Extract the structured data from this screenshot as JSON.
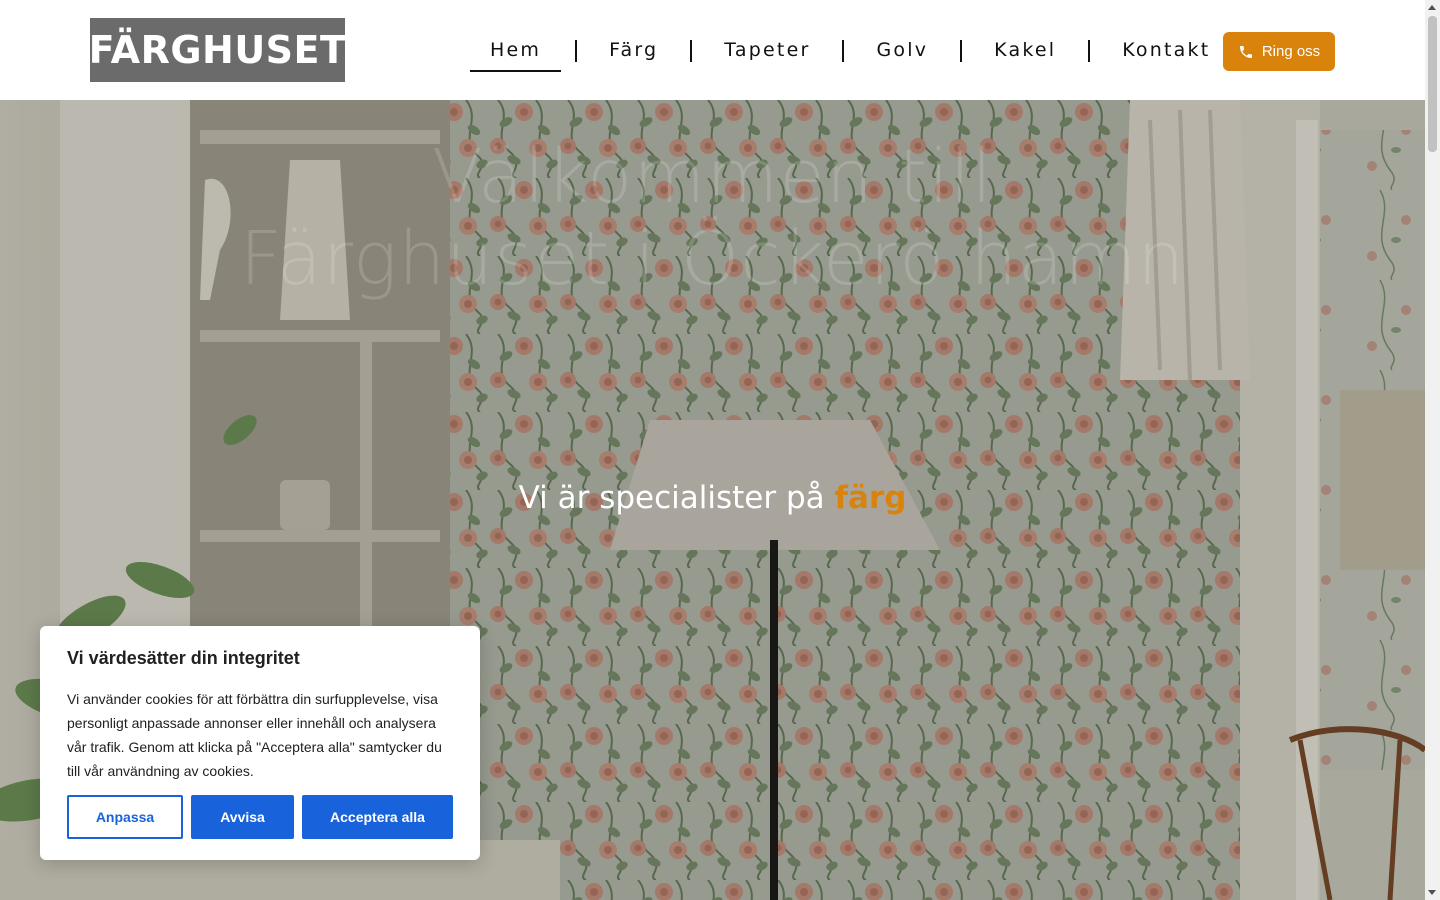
{
  "header": {
    "logo_text": "FÄRGHUSET",
    "nav": [
      {
        "label": "Hem",
        "active": true
      },
      {
        "label": "Färg"
      },
      {
        "label": "Tapeter"
      },
      {
        "label": "Golv"
      },
      {
        "label": "Kakel"
      },
      {
        "label": "Kontakt"
      }
    ],
    "call_button": {
      "label": "Ring oss",
      "icon": "phone-icon"
    }
  },
  "hero": {
    "headline_line1": "Välkommen till",
    "headline_line2": "Färghuset i Öckerö hamn",
    "subheading_prefix": "Vi är specialister på",
    "subheading_accent": "färg"
  },
  "cookie_banner": {
    "title": "Vi värdesätter din integritet",
    "text": "Vi använder cookies för att förbättra din surfupplevelse, visa personligt anpassade annonser eller innehåll och analysera vår trafik. Genom att klicka på \"Acceptera alla\" samtycker du till vår användning av cookies.",
    "buttons": {
      "customize": "Anpassa",
      "reject": "Avvisa",
      "accept": "Acceptera alla"
    }
  },
  "colors": {
    "accent": "#d9830c",
    "cookie_button": "#1863dc",
    "logo_bg": "#6b6b6b"
  }
}
